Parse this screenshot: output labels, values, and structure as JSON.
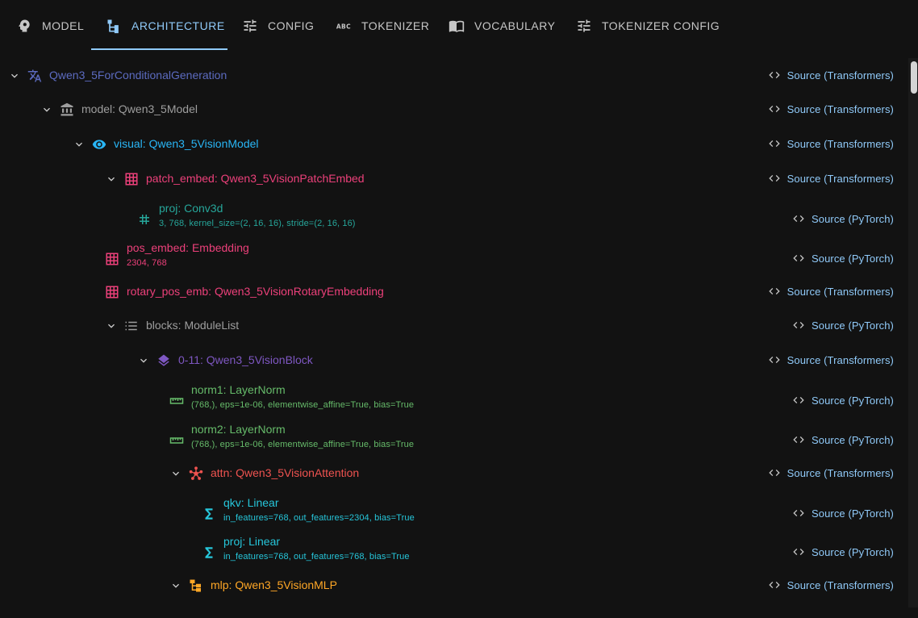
{
  "tabs": [
    {
      "label": "MODEL",
      "icon": "brain-head-icon"
    },
    {
      "label": "ARCHITECTURE",
      "icon": "file-tree-icon"
    },
    {
      "label": "CONFIG",
      "icon": "tune-icon"
    },
    {
      "label": "TOKENIZER",
      "icon": "abc-icon"
    },
    {
      "label": "VOCABULARY",
      "icon": "book-icon"
    },
    {
      "label": "TOKENIZER CONFIG",
      "icon": "tune-icon"
    }
  ],
  "active_tab": "ARCHITECTURE",
  "source_labels": {
    "transformers": "Source (Transformers)",
    "pytorch": "Source (PyTorch)"
  },
  "tree": [
    {
      "name": "Qwen3_5ForConditionalGeneration",
      "params": "",
      "icon": "translate-icon",
      "color": "#5c6bc0",
      "expanded": true,
      "source": "Source (Transformers)"
    },
    {
      "name": "model: Qwen3_5Model",
      "params": "",
      "icon": "bank-icon",
      "color": "#9e9e9e",
      "expanded": true,
      "source": "Source (Transformers)"
    },
    {
      "name": "visual: Qwen3_5VisionModel",
      "params": "",
      "icon": "eye-icon",
      "color": "#29b6f6",
      "expanded": true,
      "source": "Source (Transformers)"
    },
    {
      "name": "patch_embed: Qwen3_5VisionPatchEmbed",
      "params": "",
      "icon": "grid-icon",
      "color": "#ec407a",
      "expanded": true,
      "source": "Source (Transformers)"
    },
    {
      "name": "proj: Conv3d",
      "params": "3, 768, kernel_size=(2, 16, 16), stride=(2, 16, 16)",
      "icon": "conv-icon",
      "color": "#26a69a",
      "expanded": null,
      "source": "Source (PyTorch)"
    },
    {
      "name": "pos_embed: Embedding",
      "params": "2304, 768",
      "icon": "grid-icon",
      "color": "#ec407a",
      "expanded": null,
      "source": "Source (PyTorch)"
    },
    {
      "name": "rotary_pos_emb: Qwen3_5VisionRotaryEmbedding",
      "params": "",
      "icon": "grid-icon",
      "color": "#ec407a",
      "expanded": null,
      "source": "Source (Transformers)"
    },
    {
      "name": "blocks: ModuleList",
      "params": "",
      "icon": "list-icon",
      "color": "#9e9e9e",
      "expanded": true,
      "source": "Source (PyTorch)"
    },
    {
      "name": "0-11: Qwen3_5VisionBlock",
      "params": "",
      "icon": "layers-icon",
      "color": "#7e57c2",
      "expanded": true,
      "source": "Source (Transformers)"
    },
    {
      "name": "norm1: LayerNorm",
      "params": "(768,), eps=1e-06, elementwise_affine=True, bias=True",
      "icon": "ruler-icon",
      "color": "#66bb6a",
      "expanded": null,
      "source": "Source (PyTorch)"
    },
    {
      "name": "norm2: LayerNorm",
      "params": "(768,), eps=1e-06, elementwise_affine=True, bias=True",
      "icon": "ruler-icon",
      "color": "#66bb6a",
      "expanded": null,
      "source": "Source (PyTorch)"
    },
    {
      "name": "attn: Qwen3_5VisionAttention",
      "params": "",
      "icon": "hub-icon",
      "color": "#ef5350",
      "expanded": true,
      "source": "Source (Transformers)"
    },
    {
      "name": "qkv: Linear",
      "params": "in_features=768, out_features=2304, bias=True",
      "icon": "sigma-icon",
      "color": "#26c6da",
      "expanded": null,
      "source": "Source (PyTorch)"
    },
    {
      "name": "proj: Linear",
      "params": "in_features=768, out_features=768, bias=True",
      "icon": "sigma-icon",
      "color": "#26c6da",
      "expanded": null,
      "source": "Source (PyTorch)"
    },
    {
      "name": "mlp: Qwen3_5VisionMLP",
      "params": "",
      "icon": "sitemap-icon",
      "color": "#ffa726",
      "expanded": true,
      "source": "Source (Transformers)"
    }
  ]
}
